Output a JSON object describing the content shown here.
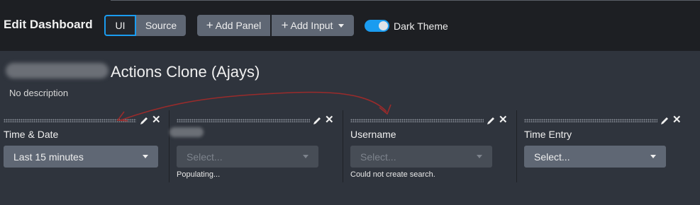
{
  "header": {
    "title": "Edit Dashboard",
    "mode_ui": "UI",
    "mode_source": "Source",
    "add_panel": "Add Panel",
    "add_input": "Add Input",
    "theme_label": "Dark Theme",
    "theme_on": true
  },
  "dashboard": {
    "title": "Actions Clone (Ajays)",
    "description": "No description"
  },
  "inputs": [
    {
      "label": "Time & Date",
      "value": "Last 15 minutes",
      "placeholder": "",
      "note": "",
      "enabled": true
    },
    {
      "label": "",
      "value": "",
      "placeholder": "Select...",
      "note": "Populating...",
      "enabled": false
    },
    {
      "label": "Username",
      "value": "",
      "placeholder": "Select...",
      "note": "Could not create search.",
      "enabled": false
    },
    {
      "label": "Time Entry",
      "value": "Select...",
      "placeholder": "",
      "note": "",
      "enabled": true
    }
  ],
  "colors": {
    "accent": "#1a9cf0",
    "annotation_arrow": "#9a2b2b"
  },
  "icons": [
    "pencil-icon",
    "close-icon",
    "plus-icon",
    "caret-down-icon"
  ]
}
